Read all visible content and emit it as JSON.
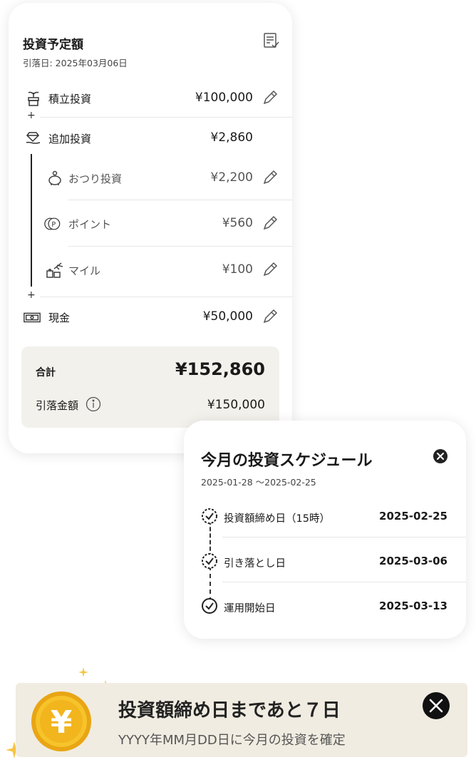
{
  "investment_card": {
    "title": "投資予定額",
    "debit_date": "引落日: 2025年03月06日",
    "rows": [
      {
        "label": "積立投資",
        "amount": "¥100,000"
      },
      {
        "label": "追加投資",
        "amount": "¥2,860"
      },
      {
        "label": "おつり投資",
        "amount": "¥2,200"
      },
      {
        "label": "ポイント",
        "amount": "¥560"
      },
      {
        "label": "マイル",
        "amount": "¥100"
      },
      {
        "label": "現金",
        "amount": "¥50,000"
      }
    ],
    "plus_symbol": "+",
    "total_label": "合計",
    "total_value": "¥152,860",
    "debit_amount_label": "引落金額",
    "debit_amount_value": "¥150,000"
  },
  "schedule_card": {
    "title": "今月の投資スケジュール",
    "range": "2025-01-28 〜2025-02-25",
    "items": [
      {
        "label": "投資額締め日（15時）",
        "date": "2025-02-25"
      },
      {
        "label": "引き落とし日",
        "date": "2025-03-06"
      },
      {
        "label": "運用開始日",
        "date": "2025-03-13"
      }
    ]
  },
  "banner": {
    "title": "投資額締め日まであと７日",
    "subtitle": "YYYY年MM月DD日に今月の投資を確定",
    "coin_symbol": "¥"
  },
  "colors": {
    "accent_gold": "#f2b51e",
    "total_bg": "#f2f1ec",
    "banner_bg": "#f0ece1"
  }
}
